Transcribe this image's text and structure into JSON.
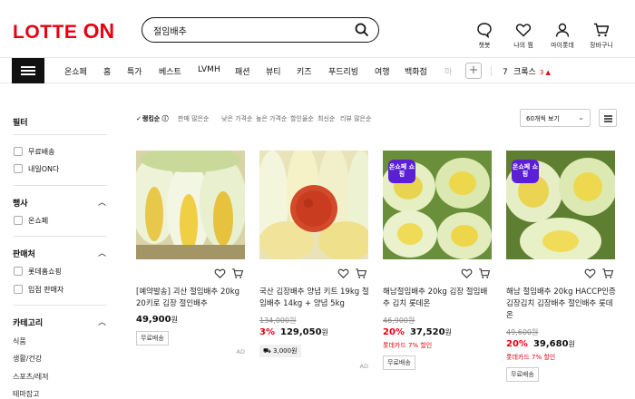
{
  "header": {
    "logo_main": "LOTTE",
    "logo_on": "ON",
    "search_value": "절임배추",
    "util": [
      {
        "label": "챗봇",
        "icon": "chatbot-icon"
      },
      {
        "label": "나의 찜",
        "icon": "heart-icon"
      },
      {
        "label": "마이롯데",
        "icon": "person-icon"
      },
      {
        "label": "장바구니",
        "icon": "cart-icon"
      }
    ]
  },
  "nav": {
    "items": [
      "온쇼페",
      "홈",
      "특가",
      "베스트",
      "LVMH",
      "패션",
      "뷰티",
      "키즈",
      "푸드리빙",
      "여행",
      "백화점",
      "마"
    ],
    "trend_rank": "7",
    "trend_word": "크록스",
    "trend_change": "3",
    "trend_arrow": "▲"
  },
  "filters": {
    "title": "필터",
    "basic": [
      "무료배송",
      "내일ON다"
    ],
    "group_company": {
      "title": "행사",
      "items": [
        "온쇼페"
      ]
    },
    "group_seller": {
      "title": "판매처",
      "items": [
        "롯데홈쇼핑",
        "입점 판매자"
      ]
    },
    "group_category": {
      "title": "카테고리",
      "items": [
        "식품",
        "생활/건강",
        "스포츠/레저",
        "테마잡고"
      ]
    }
  },
  "sort": {
    "options": [
      "랭킹순",
      "판매 많은순",
      "낮은 가격순",
      "높은 가격순",
      "할인율순",
      "최신순",
      "리뷰 많은순"
    ],
    "info_icon": "ⓘ",
    "page_size": "60개씩 보기"
  },
  "products": [
    {
      "name": "[예약발송] 괴산 절임배추 20kg 20키로 김장 절인배추",
      "original_price": "",
      "discount": "",
      "price": "49,900",
      "won": "원",
      "promo": "",
      "tag": "무료배송",
      "coupon": "",
      "ad": "AD",
      "onshope": ""
    },
    {
      "name": "국산 김장배추 양념 키트 19kg 절임배추 14kg + 양념 5kg",
      "original_price": "134,000원",
      "discount": "3%",
      "price": "129,050",
      "won": "원",
      "promo": "",
      "tag": "",
      "coupon": "3,000원",
      "ad": "AD",
      "onshope": ""
    },
    {
      "name": "해남절임배추 20kg 김장 절임배추 김치 롯데온",
      "original_price": "46,900원",
      "discount": "20%",
      "price": "37,520",
      "won": "원",
      "promo": "롯데카드 7% 할인",
      "tag": "무료배송",
      "coupon": "",
      "ad": "",
      "onshope": "온쇼페 쇼핑"
    },
    {
      "name": "해남 절임배추 20kg HACCP인증 김장김치 김장배추 절인배추 롯데온",
      "original_price": "49,600원",
      "discount": "20%",
      "price": "39,680",
      "won": "원",
      "promo": "롯데카드 7% 할인",
      "tag": "무료배송",
      "coupon": "",
      "ad": "",
      "onshope": "온쇼페 쇼핑"
    }
  ]
}
